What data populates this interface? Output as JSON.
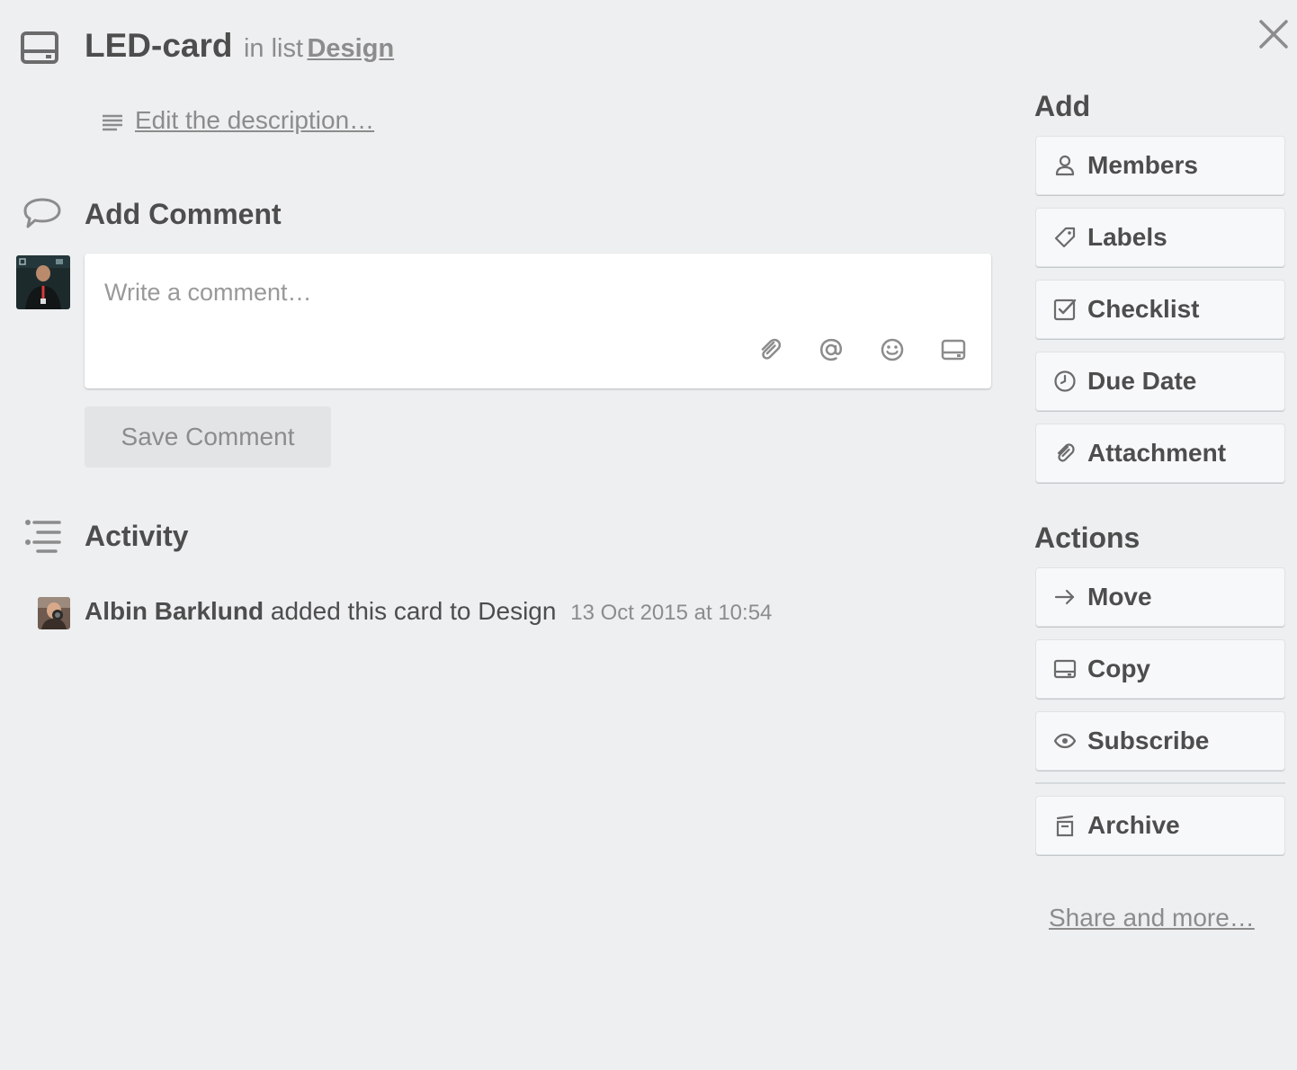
{
  "card": {
    "title": "LED-card",
    "in_list_prefix": "in list",
    "list_name": "Design",
    "edit_description": "Edit the description…"
  },
  "comment": {
    "heading": "Add Comment",
    "placeholder": "Write a comment…",
    "save_label": "Save Comment"
  },
  "activity": {
    "heading": "Activity",
    "entries": [
      {
        "user": "Albin Barklund",
        "action": "added this card to Design",
        "time": "13 Oct 2015 at 10:54"
      }
    ]
  },
  "sidebar": {
    "add_heading": "Add",
    "add_items": [
      {
        "label": "Members",
        "icon": "person-icon"
      },
      {
        "label": "Labels",
        "icon": "tag-icon"
      },
      {
        "label": "Checklist",
        "icon": "checkbox-icon"
      },
      {
        "label": "Due Date",
        "icon": "clock-icon"
      },
      {
        "label": "Attachment",
        "icon": "paperclip-icon"
      }
    ],
    "actions_heading": "Actions",
    "action_items": [
      {
        "label": "Move",
        "icon": "arrow-right-icon"
      },
      {
        "label": "Copy",
        "icon": "card-icon"
      },
      {
        "label": "Subscribe",
        "icon": "eye-icon"
      },
      {
        "label": "Archive",
        "icon": "archive-icon"
      }
    ],
    "share_link": "Share and more…"
  },
  "colors": {
    "background": "#edeff0",
    "text": "#4d4d4d",
    "muted": "#8c8c8c",
    "button_bg": "#f7f8f9"
  }
}
